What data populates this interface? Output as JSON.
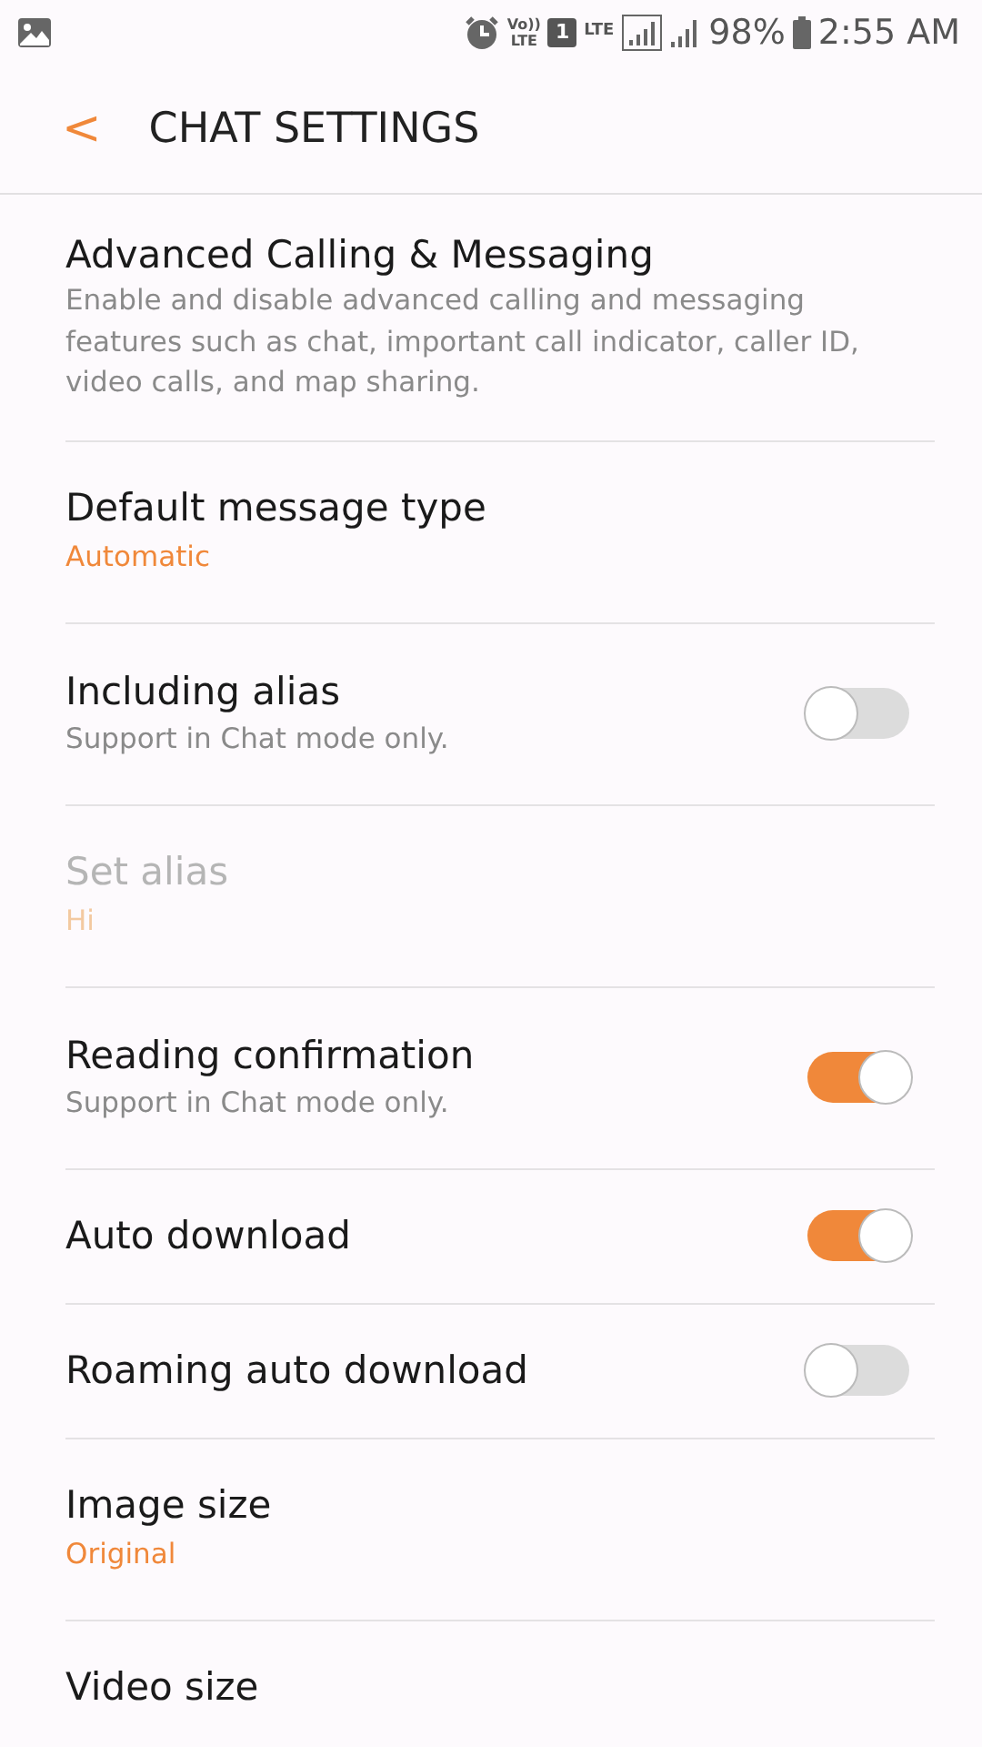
{
  "status_bar": {
    "volte_top": "Vo))",
    "volte_bottom": "LTE",
    "sim": "1",
    "network": "LTE",
    "battery": "98%",
    "time": "2:55 AM"
  },
  "header": {
    "back": "<",
    "title": "CHAT SETTINGS"
  },
  "settings": [
    {
      "kind": "text",
      "title": "Advanced Calling & Messaging",
      "summary": "Enable and disable advanced calling and messaging features such as chat, important call indicator, caller ID, video calls, and map sharing.",
      "disabled": false
    },
    {
      "kind": "value",
      "title": "Default message type",
      "value": "Automatic",
      "disabled": false
    },
    {
      "kind": "toggle",
      "title": "Including alias",
      "summary": "Support in Chat mode only.",
      "on": false,
      "disabled": false
    },
    {
      "kind": "value",
      "title": "Set alias",
      "value": "Hi",
      "disabled": true
    },
    {
      "kind": "toggle",
      "title": "Reading confirmation",
      "summary": "Support in Chat mode only.",
      "on": true,
      "disabled": false
    },
    {
      "kind": "toggle",
      "title": "Auto download",
      "on": true,
      "disabled": false
    },
    {
      "kind": "toggle",
      "title": "Roaming auto download",
      "on": false,
      "disabled": false
    },
    {
      "kind": "value",
      "title": "Image size",
      "value": "Original",
      "disabled": false
    },
    {
      "kind": "text",
      "title": "Video size",
      "disabled": false
    }
  ]
}
